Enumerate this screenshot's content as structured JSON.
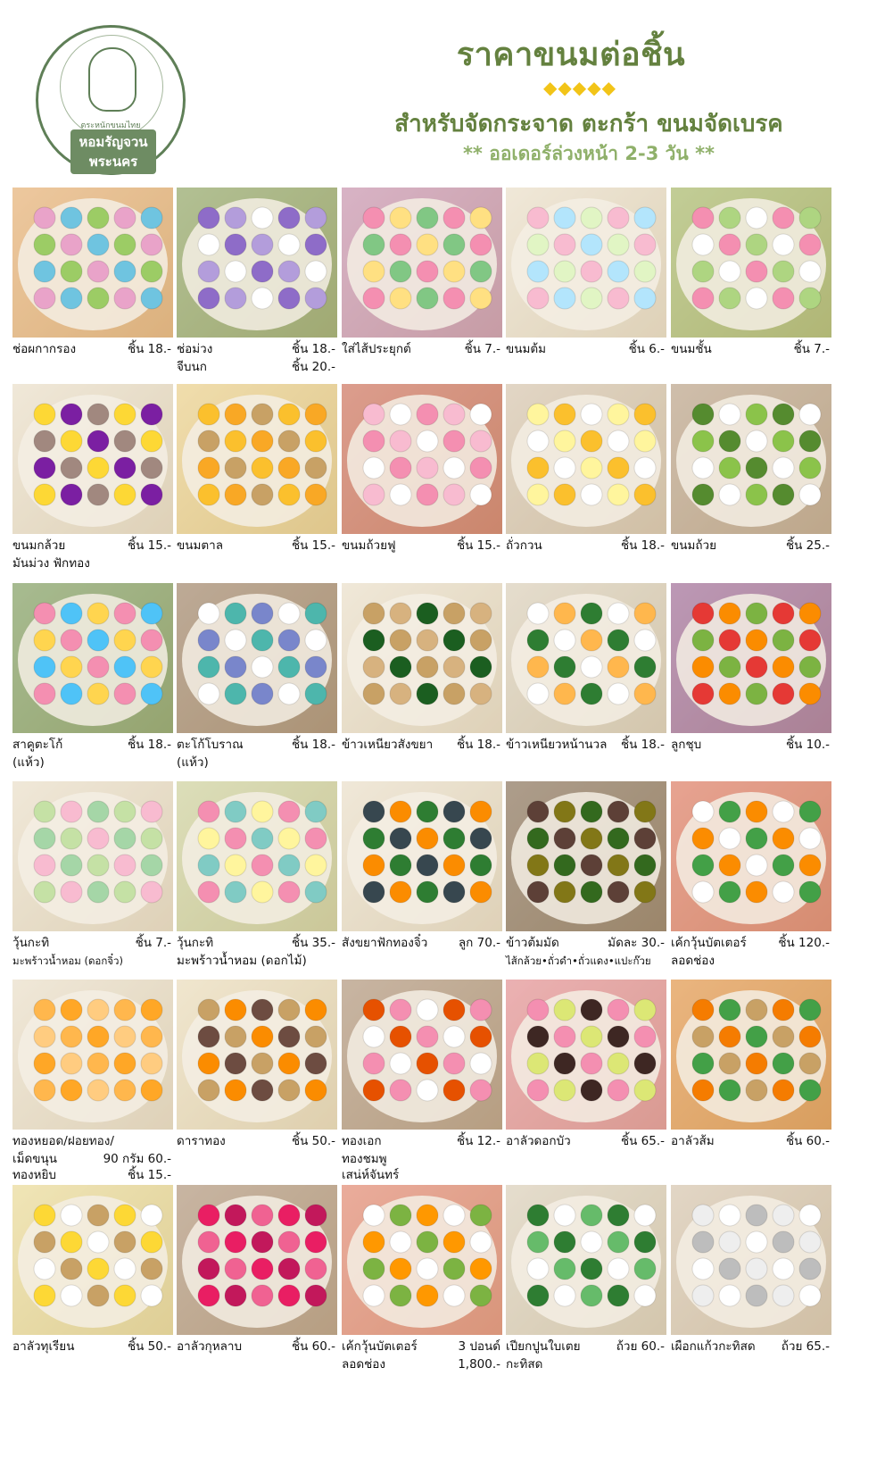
{
  "header": {
    "logo_top_text": "ตำรับไทย",
    "logo_sub": "ตระหนักขนมไทย",
    "logo_name_line1": "หอมรัญจวน",
    "logo_name_line2": "พระนคร",
    "title": "ราคาขนมต่อชิ้น",
    "diamonds": "◆◆◆◆◆",
    "subtitle": "สำหรับจัดกระจาด ตะกร้า ขนมจัดเบรค",
    "note": "** ออเดอร์ล่วงหน้า 2-3 วัน **"
  },
  "colors": {
    "brand_green": "#64813f",
    "accent_gold": "#f2c418",
    "note_green": "#8fb06a"
  },
  "items": [
    {
      "name": "ช่อผกากรอง",
      "price": "ชิ้น 18.-",
      "photo": [
        "#e9a3c9",
        "#6fc4e0",
        "#9ccc65",
        "#f5a25a"
      ]
    },
    {
      "name": "ช่อม่วง",
      "price": "ชิ้น 18.-",
      "name2": "จีบนก",
      "price2": "ชิ้น 20.-",
      "photo": [
        "#8e6cc8",
        "#b39ddb",
        "#ffffff",
        "#4c8c3a"
      ]
    },
    {
      "name": "ใส่ไส้ประยุกต์",
      "price": "ชิ้น 7.-",
      "photo": [
        "#f48fb1",
        "#ffe082",
        "#81c784",
        "#ba68c8"
      ]
    },
    {
      "name": "ขนมต้ม",
      "price": "ชิ้น 6.-",
      "photo": [
        "#f8bbd0",
        "#b3e5fc",
        "#e1f5c4",
        "#ffffff"
      ]
    },
    {
      "name": "ขนมชั้น",
      "price": "ชิ้น 7.-",
      "photo": [
        "#f48fb1",
        "#aed581",
        "#ffffff",
        "#7cb342"
      ]
    },
    {
      "name": "ขนมกล้วย",
      "price": "ชิ้น 15.-",
      "name2": "มันม่วง ฟักทอง",
      "photo": [
        "#fdd835",
        "#7b1fa2",
        "#a1887f",
        "#ffffff"
      ]
    },
    {
      "name": "ขนมตาล",
      "price": "ชิ้น 15.-",
      "photo": [
        "#fbc02d",
        "#f9a825",
        "#c8a165",
        "#ffe082"
      ]
    },
    {
      "name": "ขนมถ้วยฟู",
      "price": "ชิ้น 15.-",
      "photo": [
        "#f8bbd0",
        "#ffffff",
        "#f48fb1",
        "#c62828"
      ]
    },
    {
      "name": "ถั่วกวน",
      "price": "ชิ้น 18.-",
      "photo": [
        "#fff59d",
        "#fbc02d",
        "#ffffff",
        "#d7ccc8"
      ]
    },
    {
      "name": "ขนมถ้วย",
      "price": "ชิ้น 25.-",
      "photo": [
        "#558b2f",
        "#ffffff",
        "#8bc34a",
        "#a1887f"
      ]
    },
    {
      "name": "สาคูตะโก้",
      "price": "ชิ้น 18.-",
      "name2": "(แห้ว)",
      "photo": [
        "#f48fb1",
        "#4fc3f7",
        "#ffd54f",
        "#2e7d32"
      ]
    },
    {
      "name": "ตะโก้โบราณ",
      "price": "ชิ้น 18.-",
      "name2": "(แห้ว)",
      "photo": [
        "#ffffff",
        "#4db6ac",
        "#7986cb",
        "#6d4c41"
      ]
    },
    {
      "name": "ข้าวเหนียวสังขยา",
      "price": "ชิ้น 18.-",
      "photo": [
        "#c8a165",
        "#d7b27f",
        "#1b5e20",
        "#ffffff"
      ]
    },
    {
      "name": "ข้าวเหนียวหน้านวล",
      "price": "ชิ้น 18.-",
      "photo": [
        "#ffffff",
        "#ffb74d",
        "#2e7d32",
        "#e0e0e0"
      ]
    },
    {
      "name": "ลูกชุบ",
      "price": "ชิ้น 10.-",
      "photo": [
        "#e53935",
        "#fb8c00",
        "#7cb342",
        "#6a1b9a"
      ]
    },
    {
      "name": "วุ้นกะทิ",
      "price": "ชิ้น 7.-",
      "name2": "มะพร้าวน้ำหอม (ดอกจิ๋ว)",
      "photo": [
        "#c5e1a5",
        "#f8bbd0",
        "#a5d6a7",
        "#ffffff"
      ]
    },
    {
      "name": "วุ้นกะทิ",
      "price": "ชิ้น 35.-",
      "name2": "มะพร้าวน้ำหอม (ดอกไม้)",
      "photo": [
        "#f48fb1",
        "#80cbc4",
        "#fff59d",
        "#c5e1a5"
      ]
    },
    {
      "name": "สังขยาฟักทองจิ๋ว",
      "price": "ลูก 70.-",
      "photo": [
        "#37474f",
        "#fb8c00",
        "#2e7d32",
        "#ffffff"
      ]
    },
    {
      "name": "ข้าวต้มมัด",
      "price": "มัดละ 30.-",
      "name2": "ไส้กล้วย•ถั่วดำ•ถั่วแดง•แปะก๊วย",
      "photo": [
        "#5d4037",
        "#827717",
        "#33691e",
        "#3e2723"
      ]
    },
    {
      "name": "เค้กวุ้นบัตเตอร์",
      "price": "ชิ้น 120.-",
      "name2": "ลอดช่อง",
      "photo": [
        "#ffffff",
        "#43a047",
        "#fb8c00",
        "#e53935"
      ]
    },
    {
      "name": "ทองหยอด/ฝอยทอง/",
      "price": "",
      "name2": "เม็ดขนุน",
      "price2": "90 กรัม 60.-",
      "name3": "ทองหยิบ",
      "price3": "ชิ้น 15.-",
      "photo": [
        "#ffb74d",
        "#ffa726",
        "#ffcc80",
        "#ffffff"
      ]
    },
    {
      "name": "ดาราทอง",
      "price": "ชิ้น 50.-",
      "photo": [
        "#c8a165",
        "#fb8c00",
        "#6d4c41",
        "#fff8e1"
      ]
    },
    {
      "name": "ทองเอก",
      "price": "ชิ้น 12.-",
      "name2": "ทองชมพู",
      "name3": "เสน่ห์จันทร์",
      "photo": [
        "#e65100",
        "#f48fb1",
        "#ffffff",
        "#8d6e63"
      ]
    },
    {
      "name": "อาลัวดอกบัว",
      "price": "ชิ้น 65.-",
      "photo": [
        "#f48fb1",
        "#dce775",
        "#3e2723",
        "#f06292"
      ]
    },
    {
      "name": "อาลัวส้ม",
      "price": "ชิ้น 60.-",
      "photo": [
        "#f57c00",
        "#43a047",
        "#c8a165",
        "#ef6c00"
      ]
    },
    {
      "name": "อาลัวทุเรียน",
      "price": "ชิ้น 50.-",
      "photo": [
        "#fdd835",
        "#ffffff",
        "#c8a165",
        "#fff59d"
      ]
    },
    {
      "name": "อาลัวกุหลาบ",
      "price": "ชิ้น 60.-",
      "photo": [
        "#e91e63",
        "#c2185b",
        "#f06292",
        "#8d6e63"
      ]
    },
    {
      "name": "เค้กวุ้นบัตเตอร์",
      "price": "3 ปอนด์",
      "name2": "ลอดช่อง",
      "price2": "1,800.-",
      "photo": [
        "#ffffff",
        "#7cb342",
        "#ff9800",
        "#ef5350"
      ]
    },
    {
      "name": "เปียกปูนใบเตย",
      "price": "ถ้วย 60.-",
      "name2": "กะทิสด",
      "photo": [
        "#2e7d32",
        "#ffffff",
        "#66bb6a",
        "#e0e0e0"
      ]
    },
    {
      "name": "เผือกแก้วกะทิสด",
      "price": "ถ้วย 65.-",
      "photo": [
        "#eeeeee",
        "#ffffff",
        "#bdbdbd",
        "#d7ccc8"
      ]
    }
  ]
}
